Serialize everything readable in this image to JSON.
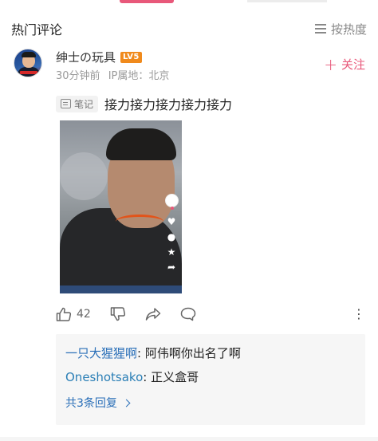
{
  "header": {
    "title": "热门评论",
    "sort_label": "按热度",
    "sort_icon": "list-icon"
  },
  "comment": {
    "username": "绅士の玩具",
    "level_badge": "LV5",
    "time": "30分钟前",
    "ip_location": "IP属地：北京",
    "follow_label": "关注",
    "note_tag": "笔记",
    "text": "接力接力接力接力接力",
    "video_overlay_icons": [
      "avatar",
      "heart-icon",
      "comment-icon",
      "star-icon",
      "share-icon"
    ],
    "like_count": "42",
    "action_icons": [
      "thumbs-up-icon",
      "thumbs-down-icon",
      "share-icon",
      "comment-icon"
    ],
    "more_label": "⋮"
  },
  "replies": {
    "items": [
      {
        "name": "一只大猩猩啊",
        "text": "阿伟啊你出名了啊"
      },
      {
        "name": "Oneshotsako",
        "text": "正义盒哥"
      }
    ],
    "more_label": "共3条回复"
  },
  "colors": {
    "accent": "#e8587a",
    "link": "#2a6fb8",
    "badge": "#f08a1c"
  }
}
